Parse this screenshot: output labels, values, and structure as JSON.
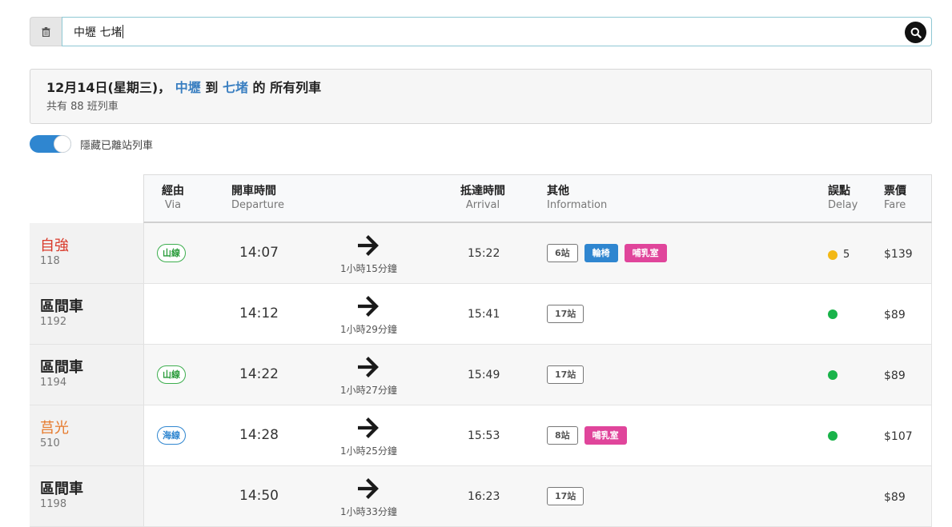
{
  "search": {
    "value": "中壢 七堵",
    "clear_icon": "trash-icon",
    "submit_icon": "search-icon"
  },
  "summary": {
    "date": "12月14日(星期三)，",
    "from": "中壢",
    "to_word": "到",
    "to": "七堵",
    "suffix": "的 所有列車",
    "count": "共有 88 班列車"
  },
  "toggle": {
    "label": "隱藏已離站列車",
    "on": true
  },
  "columns": {
    "via": {
      "zh": "經由",
      "en": "Via"
    },
    "departure": {
      "zh": "開車時間",
      "en": "Departure"
    },
    "arrival": {
      "zh": "抵達時間",
      "en": "Arrival"
    },
    "info": {
      "zh": "其他",
      "en": "Information"
    },
    "delay": {
      "zh": "誤點",
      "en": "Delay"
    },
    "fare": {
      "zh": "票價",
      "en": "Fare"
    }
  },
  "trains": [
    {
      "type": "自強",
      "no": "118",
      "via": "山線",
      "dep": "14:07",
      "duration": "1小時15分鐘",
      "arr": "15:22",
      "stops": "6站",
      "wheelchair": "輪椅",
      "nursing": "哺乳室",
      "delay_status": "yellow",
      "delay_min": "5",
      "fare": "$139"
    },
    {
      "type": "區間車",
      "no": "1192",
      "via": "",
      "dep": "14:12",
      "duration": "1小時29分鐘",
      "arr": "15:41",
      "stops": "17站",
      "wheelchair": "",
      "nursing": "",
      "delay_status": "green",
      "delay_min": "",
      "fare": "$89"
    },
    {
      "type": "區間車",
      "no": "1194",
      "via": "山線",
      "dep": "14:22",
      "duration": "1小時27分鐘",
      "arr": "15:49",
      "stops": "17站",
      "wheelchair": "",
      "nursing": "",
      "delay_status": "green",
      "delay_min": "",
      "fare": "$89"
    },
    {
      "type": "莒光",
      "no": "510",
      "via": "海線",
      "dep": "14:28",
      "duration": "1小時25分鐘",
      "arr": "15:53",
      "stops": "8站",
      "wheelchair": "",
      "nursing": "哺乳室",
      "delay_status": "green",
      "delay_min": "",
      "fare": "$107"
    },
    {
      "type": "區間車",
      "no": "1198",
      "via": "",
      "dep": "14:50",
      "duration": "1小時33分鐘",
      "arr": "16:23",
      "stops": "17站",
      "wheelchair": "",
      "nursing": "",
      "delay_status": "none",
      "delay_min": "",
      "fare": "$89"
    }
  ],
  "colors": {
    "accent_blue": "#2f86d0",
    "ziqiang_red": "#d93a2b",
    "juguang_orange": "#e6792b",
    "mountain_green": "#3dae4e",
    "nursing_pink": "#e0459b",
    "delay_green": "#19b34a",
    "delay_yellow": "#f3b815"
  }
}
